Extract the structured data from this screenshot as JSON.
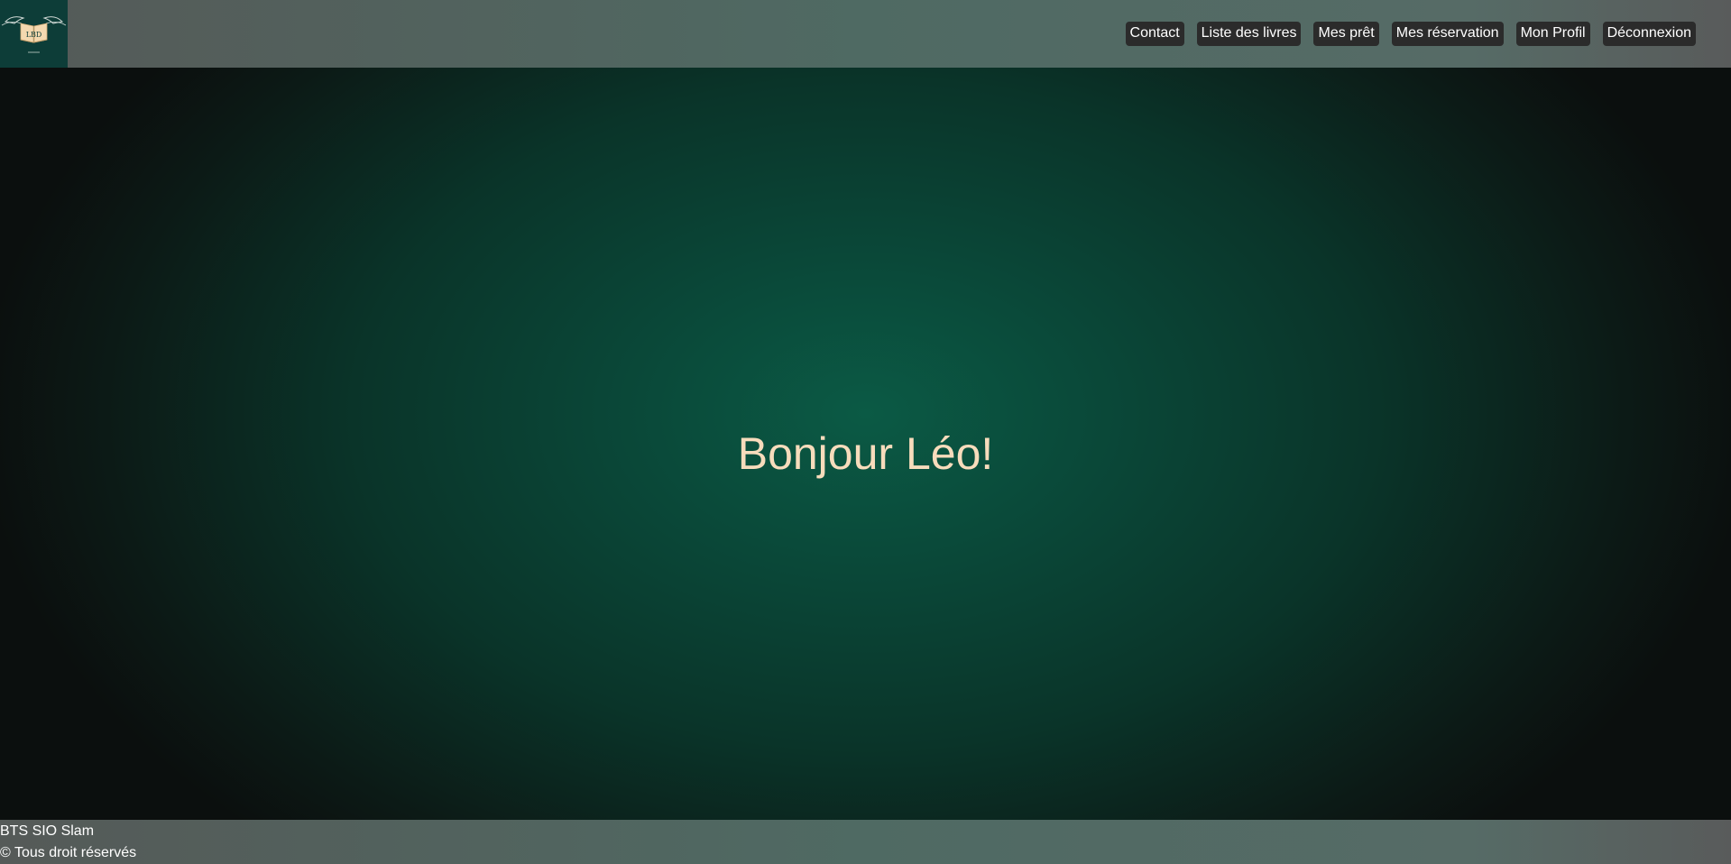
{
  "nav": {
    "items": [
      {
        "label": "Contact"
      },
      {
        "label": "Liste des livres"
      },
      {
        "label": "Mes prêt"
      },
      {
        "label": "Mes réservation"
      },
      {
        "label": "Mon Profil"
      },
      {
        "label": "Déconnexion"
      }
    ]
  },
  "logo": {
    "icon": "winged-book-logo",
    "text": "LBD"
  },
  "main": {
    "greeting": "Bonjour Léo!"
  },
  "footer": {
    "line1": "BTS SIO Slam",
    "line2": "© Tous droit réservés"
  },
  "colors": {
    "greeting_text": "#f7dcbc",
    "nav_button_bg": "#2b2b2b",
    "logo_bg": "#0d3d38",
    "header_footer_bg": "#4f6a63",
    "main_bg_center": "#0b5a45"
  }
}
